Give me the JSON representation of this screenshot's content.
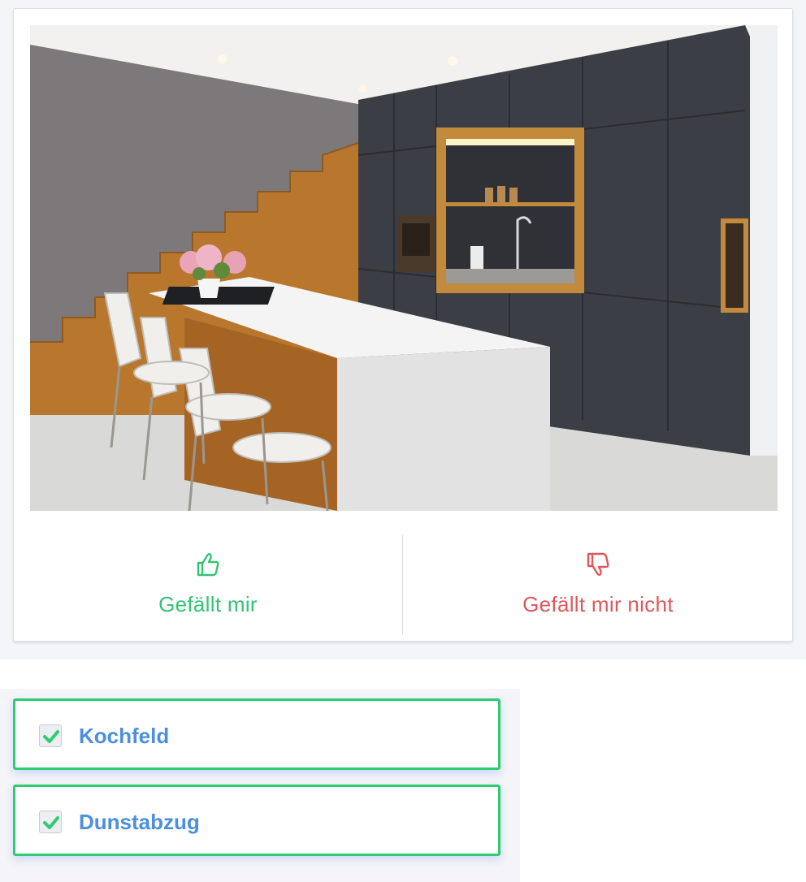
{
  "image": {
    "alt": "Moderne Küche mit Kochinsel"
  },
  "vote": {
    "like": {
      "label": "Gefällt mir",
      "icon": "thumbs-up-icon",
      "color": "#33c473"
    },
    "dislike": {
      "label": "Gefällt mir nicht",
      "icon": "thumbs-down-icon",
      "color": "#e0575a"
    }
  },
  "options": [
    {
      "label": "Kochfeld",
      "checked": true
    },
    {
      "label": "Dunstabzug",
      "checked": true
    }
  ],
  "colors": {
    "accent_green": "#2ecc71",
    "label_blue": "#4a8fe0"
  }
}
